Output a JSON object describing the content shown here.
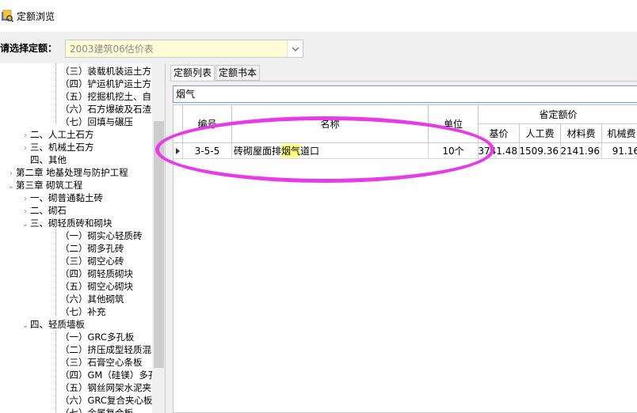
{
  "window": {
    "title": "定额浏览"
  },
  "selector": {
    "label": "请选择定额：",
    "value": "2003建筑06估价表"
  },
  "tree": {
    "items": [
      {
        "label": "（三）装载机装运土方",
        "level": 4,
        "chev": ""
      },
      {
        "label": "（四）铲运机铲运土方",
        "level": 4,
        "chev": ""
      },
      {
        "label": "（五）挖掘机挖土、自",
        "level": 4,
        "chev": ""
      },
      {
        "label": "（六）石方爆破及石渣",
        "level": 4,
        "chev": ""
      },
      {
        "label": "（七）回填与碾压",
        "level": 4,
        "chev": ""
      },
      {
        "label": "二、人工土石方",
        "level": 2,
        "chev": "›"
      },
      {
        "label": "三、机械土石方",
        "level": 2,
        "chev": "›"
      },
      {
        "label": "四、其他",
        "level": 2,
        "chev": ""
      },
      {
        "label": "第二章  地基处理与防护工程",
        "level": 1,
        "chev": "›"
      },
      {
        "label": "第三章  砌筑工程",
        "level": 1,
        "chev": "⌄"
      },
      {
        "label": "一、砌普通黏土砖",
        "level": 2,
        "chev": "›"
      },
      {
        "label": "二、砌石",
        "level": 2,
        "chev": "›"
      },
      {
        "label": "三、砌轻质砖和砌块",
        "level": 2,
        "chev": "⌄"
      },
      {
        "label": "（一）砌实心轻质砖",
        "level": 4,
        "chev": ""
      },
      {
        "label": "（二）砌多孔砖",
        "level": 4,
        "chev": ""
      },
      {
        "label": "（三）砌空心砖",
        "level": 4,
        "chev": ""
      },
      {
        "label": "（四）砌轻质砌块",
        "level": 4,
        "chev": ""
      },
      {
        "label": "（五）砌空心砌块",
        "level": 4,
        "chev": ""
      },
      {
        "label": "（六）其他砌筑",
        "level": 4,
        "chev": ""
      },
      {
        "label": "（七）补充",
        "level": 4,
        "chev": ""
      },
      {
        "label": "四、轻质墙板",
        "level": 2,
        "chev": "⌄"
      },
      {
        "label": "（一）GRC多孔板",
        "level": 4,
        "chev": ""
      },
      {
        "label": "（二）挤压成型轻质混",
        "level": 4,
        "chev": ""
      },
      {
        "label": "（三）石膏空心条板",
        "level": 4,
        "chev": ""
      },
      {
        "label": "（四）GM（硅镁）多孔",
        "level": 4,
        "chev": ""
      },
      {
        "label": "（五）钢丝网架水泥夹",
        "level": 4,
        "chev": ""
      },
      {
        "label": "（六）GRC复合夹心板",
        "level": 4,
        "chev": ""
      },
      {
        "label": "（七）金属复合板",
        "level": 4,
        "chev": ""
      }
    ]
  },
  "tabs": [
    {
      "label": "定额列表"
    },
    {
      "label": "定额书本"
    }
  ],
  "search": {
    "value": "烟气"
  },
  "table": {
    "headers": {
      "code": "编号",
      "name": "名称",
      "unit": "单位",
      "group": "省定额价",
      "base": "基价",
      "labor": "人工费",
      "material": "材料费",
      "machine": "机械费"
    },
    "rows": [
      {
        "code": "3-5-5",
        "name_pre": "砖砌屋面排",
        "name_hl": "烟气",
        "name_post": "道口",
        "unit": "10个",
        "base": "3741.48",
        "labor": "1509.36",
        "material": "2141.96",
        "machine": "91.16"
      }
    ]
  },
  "colors": {
    "highlight": "#ffff80",
    "annotation": "#e83be8",
    "combo_bg": "#fffdd8"
  }
}
